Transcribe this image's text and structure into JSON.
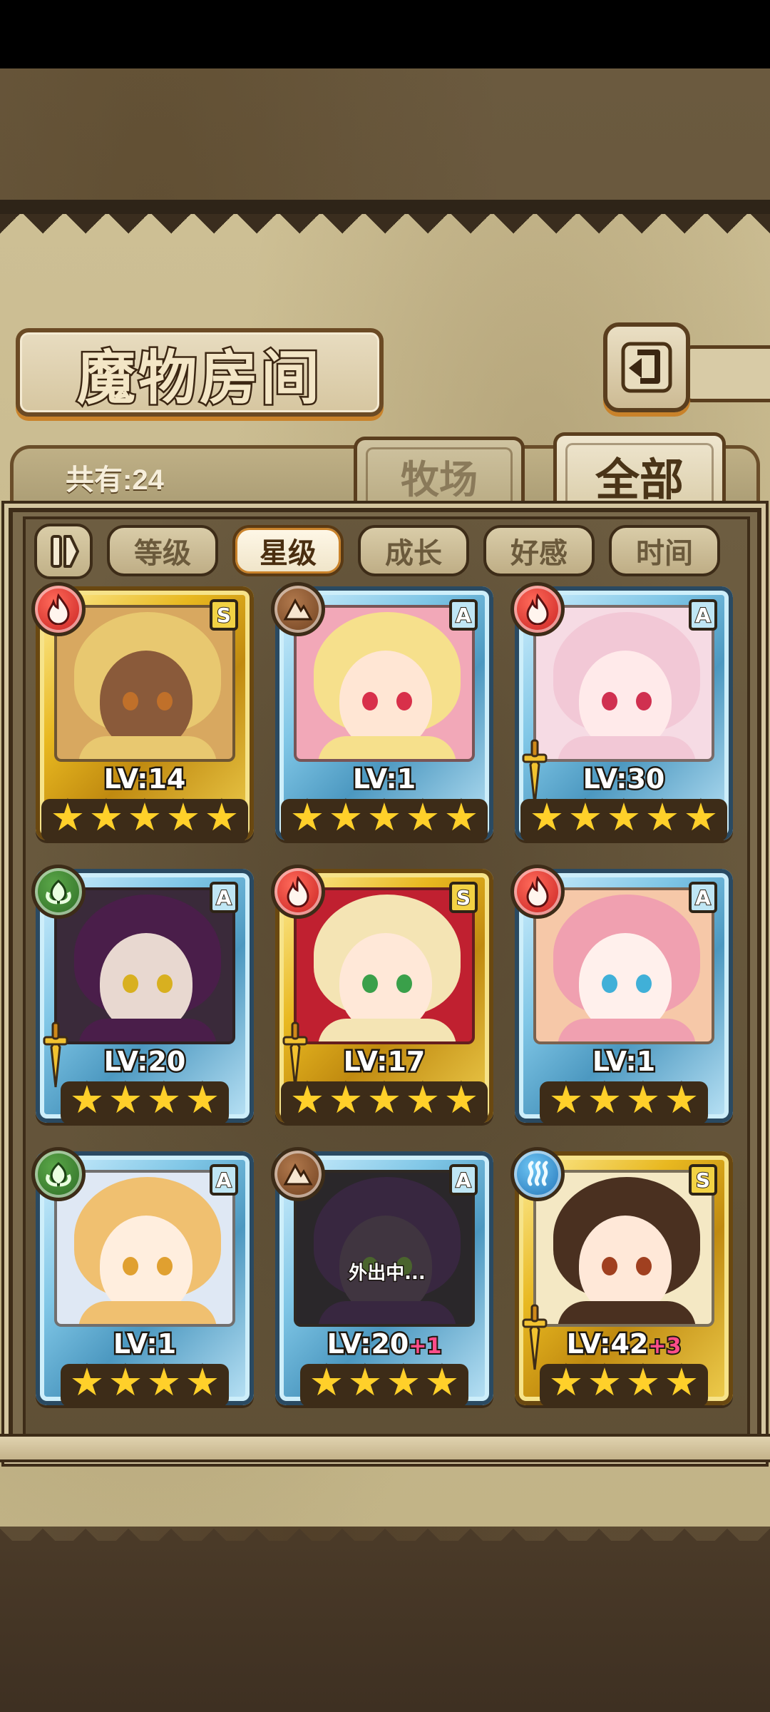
{
  "screen": {
    "title": "魔物房间",
    "count_text": "共有:24",
    "back_icon": "return-arrow-icon"
  },
  "tabs": [
    {
      "label": "牧场",
      "active": false
    },
    {
      "label": "全部",
      "active": true
    }
  ],
  "sort": {
    "toggle_icon": "pause-sort-toggle-icon",
    "options": [
      {
        "label": "等级",
        "active": false
      },
      {
        "label": "星级",
        "active": true
      },
      {
        "label": "成长",
        "active": false
      },
      {
        "label": "好感",
        "active": false
      },
      {
        "label": "时间",
        "active": false
      }
    ]
  },
  "monsters": [
    {
      "element": "fire",
      "rank": "S",
      "frame": "gold",
      "level": "LV:14",
      "plus": "",
      "stars": 5,
      "weapon": false,
      "away": "",
      "hair": "#e8c870",
      "skin": "#8a5a3a",
      "eye": "#c0702a",
      "bg": "#d8a860"
    },
    {
      "element": "earth",
      "rank": "A",
      "frame": "blue",
      "level": "LV:1",
      "plus": "",
      "stars": 5,
      "weapon": false,
      "away": "",
      "hair": "#f6e08c",
      "skin": "#ffe6d4",
      "eye": "#d8304a",
      "bg": "#f2a8b8"
    },
    {
      "element": "fire",
      "rank": "A",
      "frame": "blue",
      "level": "LV:30",
      "plus": "",
      "stars": 5,
      "weapon": true,
      "away": "",
      "hair": "#f2c8d6",
      "skin": "#ffeaea",
      "eye": "#d03050",
      "bg": "#f6dbe4"
    },
    {
      "element": "wood",
      "rank": "A",
      "frame": "blue",
      "level": "LV:20",
      "plus": "",
      "stars": 4,
      "weapon": true,
      "away": "",
      "hair": "#4a1e4a",
      "skin": "#e8d8d0",
      "eye": "#d8b020",
      "bg": "#3a2a3a"
    },
    {
      "element": "fire",
      "rank": "S",
      "frame": "gold",
      "level": "LV:17",
      "plus": "",
      "stars": 5,
      "weapon": true,
      "away": "",
      "hair": "#f4e4b4",
      "skin": "#ffe8d8",
      "eye": "#3aa04a",
      "bg": "#c02030"
    },
    {
      "element": "fire",
      "rank": "A",
      "frame": "blue",
      "level": "LV:1",
      "plus": "",
      "stars": 4,
      "weapon": false,
      "away": "",
      "hair": "#f0a0b0",
      "skin": "#fff0ec",
      "eye": "#40b0d8",
      "bg": "#f6c8a8"
    },
    {
      "element": "wood",
      "rank": "A",
      "frame": "blue",
      "level": "LV:1",
      "plus": "",
      "stars": 4,
      "weapon": false,
      "away": "",
      "hair": "#f0c070",
      "skin": "#ffeede",
      "eye": "#e0a030",
      "bg": "#dfe8f4"
    },
    {
      "element": "earth",
      "rank": "A",
      "frame": "blue",
      "level": "LV:20",
      "plus": "+1",
      "stars": 4,
      "weapon": false,
      "away": "外出中...",
      "hair": "#5a3a6a",
      "skin": "#6a5a6a",
      "eye": "#80c040",
      "bg": "#3a3a3a"
    },
    {
      "element": "water",
      "rank": "S",
      "frame": "gold",
      "level": "LV:42",
      "plus": "+3",
      "stars": 4,
      "weapon": true,
      "away": "",
      "hair": "#4a3020",
      "skin": "#ffe8d8",
      "eye": "#a04020",
      "bg": "#f4e8c4"
    }
  ]
}
